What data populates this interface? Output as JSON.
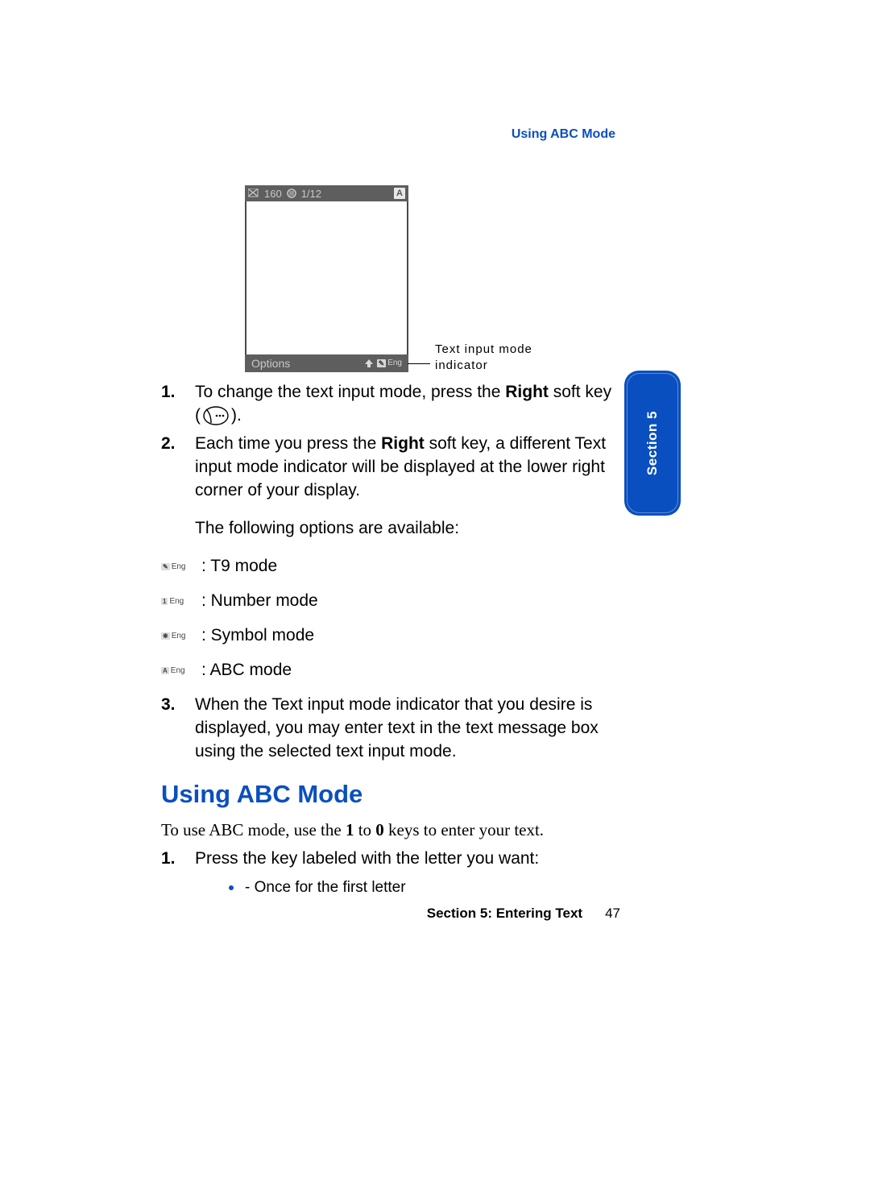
{
  "running_header": "Using ABC Mode",
  "phone": {
    "status_count": "160",
    "status_page": "1/12",
    "status_mode_letter": "A",
    "soft_left": "Options",
    "soft_right_mode": "Eng"
  },
  "annotation": {
    "line1": "Text input mode",
    "line2": "indicator"
  },
  "section_tab": "Section 5",
  "steps": {
    "s1_pre": "To change the text input mode, press the ",
    "s1_bold": "Right",
    "s1_post": " soft key (",
    "s1_tail": ").",
    "s2_pre": "Each time you press the ",
    "s2_bold": "Right",
    "s2_post": " soft key, a different Text input mode indicator will be displayed at the lower right corner of your display.",
    "available": "The following options are available:",
    "modes": {
      "t9": ": T9 mode",
      "num": ": Number mode",
      "sym": ": Symbol mode",
      "abc": ": ABC mode"
    },
    "s3": "When the Text input mode indicator that you desire is displayed, you may enter text in the text message box using the selected text input mode."
  },
  "mode_icons": {
    "t9_letter": "✎",
    "num_letter": "1",
    "sym_letter": "❋",
    "abc_letter": "A",
    "lang": "Eng"
  },
  "heading2": "Using ABC Mode",
  "serif": {
    "pre": "To use ABC mode, use the ",
    "b1": "1",
    "mid": " to ",
    "b2": "0",
    "post": " keys to enter your text."
  },
  "step_b1": "Press the key labeled with the letter you want:",
  "bullet1": "- Once for the first letter",
  "footer": {
    "label": "Section 5: Entering Text",
    "page": "47"
  }
}
